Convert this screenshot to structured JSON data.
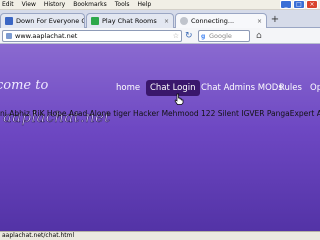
{
  "menubar": {
    "items": [
      "Edit",
      "View",
      "History",
      "Bookmarks",
      "Tools",
      "Help"
    ]
  },
  "tabs": [
    {
      "label": "Down For Everyone Or Just ...",
      "favicon_color": "#3b66c4"
    },
    {
      "label": "Play Chat Rooms",
      "favicon_color": "#2ea84a"
    },
    {
      "label": "Connecting...",
      "favicon_color": "#c0c4cc",
      "active": true
    }
  ],
  "navbar": {
    "url": "www.aaplachat.net",
    "search_placeholder": "Google"
  },
  "site": {
    "logo_top": "come to",
    "logo_bottom": "aaplachat.net",
    "nav": [
      "home",
      "Chat Login",
      "Chat Admins MODs",
      "Rules",
      "Op"
    ],
    "active_nav": "Chat Login",
    "marquee": "ni Abhiz RiK Hope Asad Alone tiger Hacker Mehmood 122 Silent IGVER PangaExpert Anmol Jutt"
  },
  "status": {
    "text": "aaplachat.net/chat.html"
  },
  "colors": {
    "page_top": "#8a6ad0",
    "page_bottom": "#5333a6",
    "active_nav_bg": "#3a176c"
  }
}
